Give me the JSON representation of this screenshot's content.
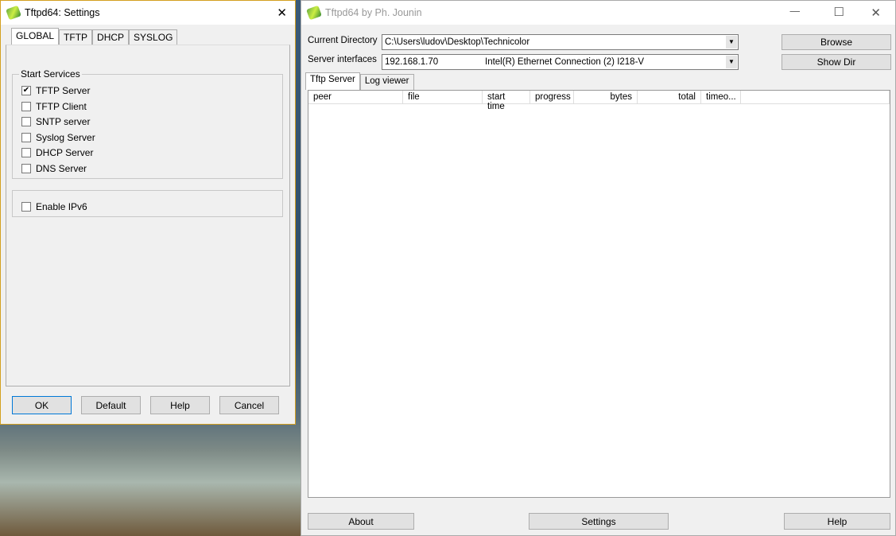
{
  "settings": {
    "title": "Tftpd64: Settings",
    "tabs": [
      "GLOBAL",
      "TFTP",
      "DHCP",
      "SYSLOG"
    ],
    "group_label": "Start Services",
    "services": [
      {
        "label": "TFTP Server",
        "checked": true
      },
      {
        "label": "TFTP Client",
        "checked": false
      },
      {
        "label": "SNTP server",
        "checked": false
      },
      {
        "label": "Syslog Server",
        "checked": false
      },
      {
        "label": "DHCP Server",
        "checked": false
      },
      {
        "label": "DNS Server",
        "checked": false
      }
    ],
    "ipv6": {
      "label": "Enable IPv6",
      "checked": false
    },
    "buttons": {
      "ok": "OK",
      "default": "Default",
      "help": "Help",
      "cancel": "Cancel"
    },
    "close": "✕"
  },
  "main": {
    "title": "Tftpd64 by Ph. Jounin",
    "dir_label": "Current Directory",
    "dir_value": "C:\\Users\\ludov\\Desktop\\Technicolor",
    "if_label": "Server interfaces",
    "if_ip": "192.168.1.70",
    "if_name": "Intel(R) Ethernet Connection (2) I218-V",
    "browse": "Browse",
    "showdir": "Show Dir",
    "tabs": [
      "Tftp Server",
      "Log viewer"
    ],
    "columns": [
      "peer",
      "file",
      "start time",
      "progress",
      "bytes",
      "total",
      "timeo..."
    ],
    "about": "About",
    "settings": "Settings",
    "help": "Help",
    "min": "—",
    "max": "☐",
    "close": "✕"
  }
}
